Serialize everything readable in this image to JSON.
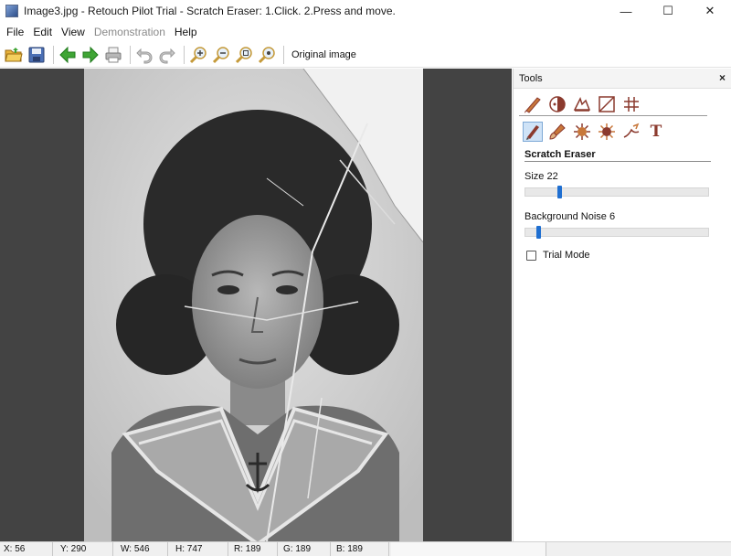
{
  "window": {
    "title": "Image3.jpg - Retouch Pilot Trial - Scratch Eraser: 1.Click. 2.Press and move.",
    "minimize": "—",
    "maximize": "☐",
    "close": "✕"
  },
  "menu": [
    {
      "label": "File",
      "enabled": true
    },
    {
      "label": "Edit",
      "enabled": true
    },
    {
      "label": "View",
      "enabled": true
    },
    {
      "label": "Demonstration",
      "enabled": false
    },
    {
      "label": "Help",
      "enabled": true
    }
  ],
  "toolbar": {
    "original_image_label": "Original image"
  },
  "tools_panel": {
    "title": "Tools",
    "close_glyph": "×",
    "active_tool_name": "Scratch Eraser",
    "size_label": "Size 22",
    "size_value": 22,
    "background_noise_label": "Background Noise 6",
    "background_noise_value": 6,
    "trial_mode_label": "Trial Mode",
    "trial_mode_checked": false,
    "text_tool_glyph": "T"
  },
  "status": {
    "x": "X: 56",
    "y": "Y: 290",
    "w": "W: 546",
    "h": "H: 747",
    "r": "R: 189",
    "g": "G: 189",
    "b": "B: 189"
  },
  "colors": {
    "canvas_background": "#434343",
    "slider_thumb": "#1f6fd1",
    "icon_brown": "#8b3a2e",
    "icon_green": "#3fa535"
  }
}
